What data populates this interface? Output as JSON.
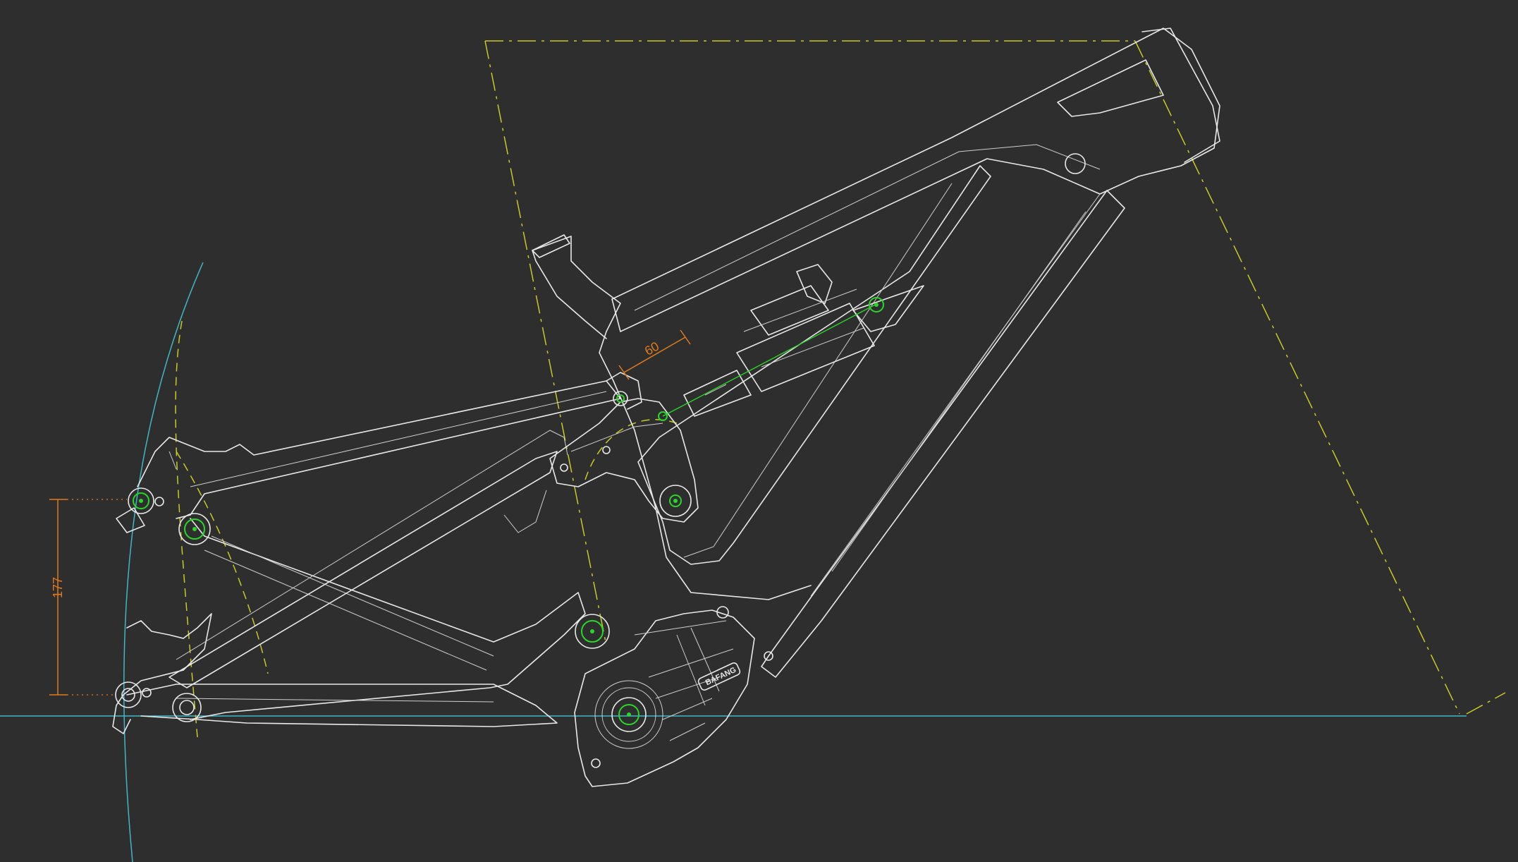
{
  "drawing": {
    "dimensions": {
      "vertical_dim": "177",
      "shock_dim": "60"
    },
    "motor_brand": "BAFANG",
    "colors": {
      "background": "#2e2e2e",
      "frame_lines": "#e8e8e8",
      "reference_lines": "#c9c928",
      "ground_and_arc": "#3fb7c7",
      "dimension": "#e07a1f",
      "pivot": "#2ad62a"
    },
    "pivots": [
      {
        "name": "rear-dropout-pivot"
      },
      {
        "name": "seatstay-chainstay-pivot"
      },
      {
        "name": "main-pivot"
      },
      {
        "name": "rocker-pivot"
      },
      {
        "name": "shock-eye-pivot"
      },
      {
        "name": "shock-mount-pivot"
      },
      {
        "name": "bottom-bracket"
      }
    ]
  }
}
